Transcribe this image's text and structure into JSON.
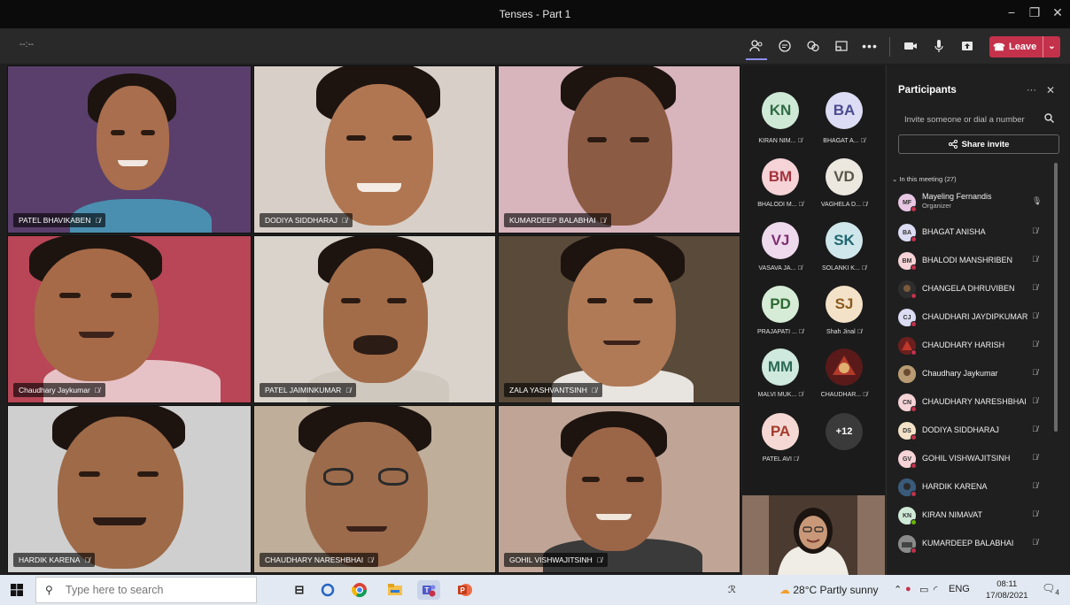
{
  "window": {
    "title": "Tenses - Part 1",
    "minimize": "−",
    "restore": "❐",
    "close": "✕"
  },
  "toolbar": {
    "timer": "--:--",
    "leave_label": "Leave",
    "buttons": [
      "people-icon",
      "chat-icon",
      "reactions-icon",
      "rooms-icon",
      "more-icon",
      "camera-icon",
      "mic-icon",
      "share-icon"
    ]
  },
  "video_tiles": [
    {
      "name": "PATEL BHAVIKABEN"
    },
    {
      "name": "DODIYA SIDDHARAJ"
    },
    {
      "name": "KUMARDEEP BALABHAI"
    },
    {
      "name": "Chaudhary Jaykumar"
    },
    {
      "name": "PATEL JAIMINKUMAR"
    },
    {
      "name": "ZALA YASHVANTSINH"
    },
    {
      "name": "HARDIK KARENA"
    },
    {
      "name": "CHAUDHARY NARESHBHAI"
    },
    {
      "name": "GOHIL VISHWAJITSINH"
    }
  ],
  "roster": [
    {
      "initials": "KN",
      "name": "KIRAN NIM...",
      "color": "#cfe9d7",
      "text_color": "#2f6b43"
    },
    {
      "initials": "BA",
      "name": "BHAGAT A...",
      "color": "#dcdcf4",
      "text_color": "#4b4b8f"
    },
    {
      "initials": "BM",
      "name": "BHALODI M...",
      "color": "#f5d3d6",
      "text_color": "#a3323e"
    },
    {
      "initials": "VD",
      "name": "VAGHELA D...",
      "color": "#ece8e0",
      "text_color": "#5b5548"
    },
    {
      "initials": "VJ",
      "name": "VASAVA JA...",
      "color": "#efd9ec",
      "text_color": "#7d2f72"
    },
    {
      "initials": "SK",
      "name": "SOLANKI K...",
      "color": "#cfe7ea",
      "text_color": "#1f6670"
    },
    {
      "initials": "PD",
      "name": "PRAJAPATI ...",
      "color": "#d6ecd6",
      "text_color": "#2f6a34"
    },
    {
      "initials": "SJ",
      "name": "Shah Jinal",
      "color": "#f3e2c8",
      "text_color": "#8a5a1c"
    },
    {
      "initials": "MM",
      "name": "MALVI MUK...",
      "color": "#cfe9df",
      "text_color": "#2a6a56"
    },
    {
      "initials": "",
      "name": "CHAUDHAR...",
      "color": "#5a1a1a",
      "text_color": "#ffffff"
    },
    {
      "initials": "PA",
      "name": "PATEL AVI",
      "color": "#f5d8d3",
      "text_color": "#a33d2e"
    },
    {
      "initials": "+12",
      "name": "",
      "color": "#3a3a3a",
      "text_color": "#ffffff"
    }
  ],
  "panel": {
    "title": "Participants",
    "invite_placeholder": "Invite someone or dial a number",
    "share_invite": "Share invite",
    "in_meeting": "In this meeting (27)",
    "organizer_label": "Organizer",
    "participants": [
      {
        "initials": "MF",
        "name": "Mayeling Fernandis",
        "color": "#e8c7e4",
        "organizer": true
      },
      {
        "initials": "BA",
        "name": "BHAGAT ANISHA",
        "color": "#dcdcf4"
      },
      {
        "initials": "BM",
        "name": "BHALODI MANSHRIBEN",
        "color": "#f5d3d6"
      },
      {
        "initials": "",
        "name": "CHANGELA DHRUVIBEN",
        "color": "#2d2d2d"
      },
      {
        "initials": "CJ",
        "name": "CHAUDHARI JAYDIPKUMAR",
        "color": "#dcdcf4"
      },
      {
        "initials": "",
        "name": "CHAUDHARY HARISH",
        "color": "#6b1f1f"
      },
      {
        "initials": "",
        "name": "Chaudhary Jaykumar",
        "color": "#b89b72"
      },
      {
        "initials": "CN",
        "name": "CHAUDHARY NARESHBHAI",
        "color": "#f5d3d6"
      },
      {
        "initials": "DS",
        "name": "DODIYA SIDDHARAJ",
        "color": "#f3e2c8"
      },
      {
        "initials": "GV",
        "name": "GOHIL VISHWAJITSINH",
        "color": "#f5d3d6"
      },
      {
        "initials": "",
        "name": "HARDIK KARENA",
        "color": "#3a5a7a"
      },
      {
        "initials": "KN",
        "name": "KIRAN NIMAVAT",
        "color": "#cfe9d7"
      },
      {
        "initials": "",
        "name": "KUMARDEEP BALABHAI",
        "color": "#8a8a8a"
      }
    ]
  },
  "taskbar": {
    "search_placeholder": "Type here to search",
    "weather": "28°C  Partly sunny",
    "lang": "ENG",
    "time": "08:11",
    "date": "17/08/2021",
    "notif_count": "4"
  }
}
